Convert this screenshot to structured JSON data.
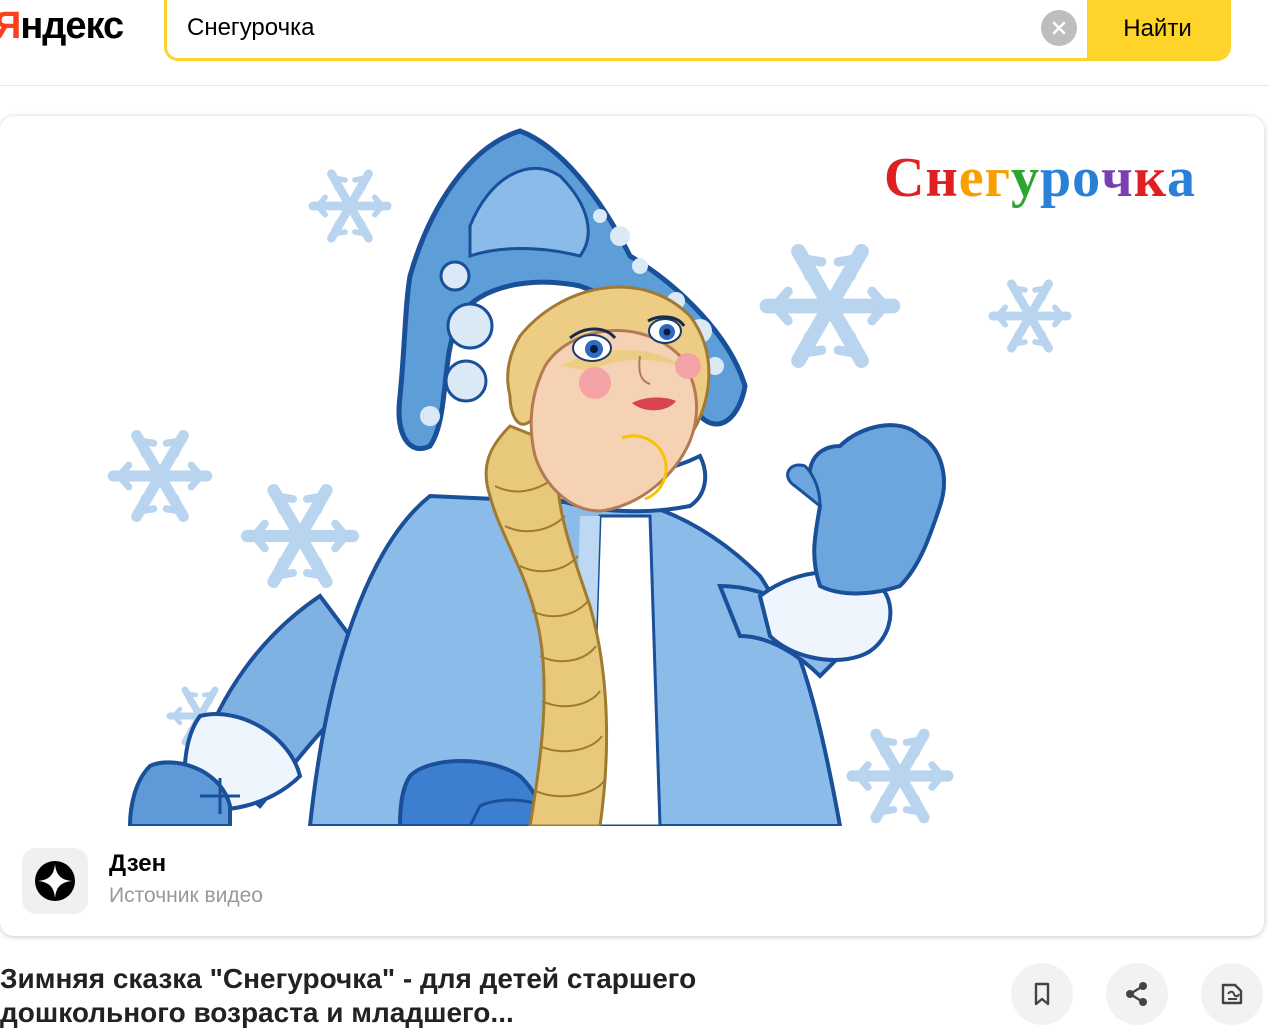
{
  "header": {
    "logo_first": "Я",
    "logo_rest": "ндекс",
    "search_value": "Снегурочка",
    "find_label": "Найти",
    "accent_color": "#fed42b",
    "logo_color": "#fc3f1d"
  },
  "card": {
    "media_title_letters": [
      "С",
      "н",
      "е",
      "г",
      "у",
      "р",
      "о",
      "ч",
      "к",
      "а"
    ],
    "media_title_colors": [
      "#e02020",
      "#e02020",
      "#f7a000",
      "#f7a000",
      "#2ea52e",
      "#2a7fd6",
      "#2a7fd6",
      "#7a3fb0",
      "#e02020",
      "#2a7fd6"
    ],
    "source_name": "Дзен",
    "source_sub": "Источник видео",
    "source_icon": "zen-star-icon"
  },
  "video": {
    "title": "Зимняя сказка \"Снегурочка\" - для детей старшего дошкольного возраста и младшего...",
    "actions": [
      "bookmark-icon",
      "share-icon",
      "feedback-icon"
    ]
  }
}
